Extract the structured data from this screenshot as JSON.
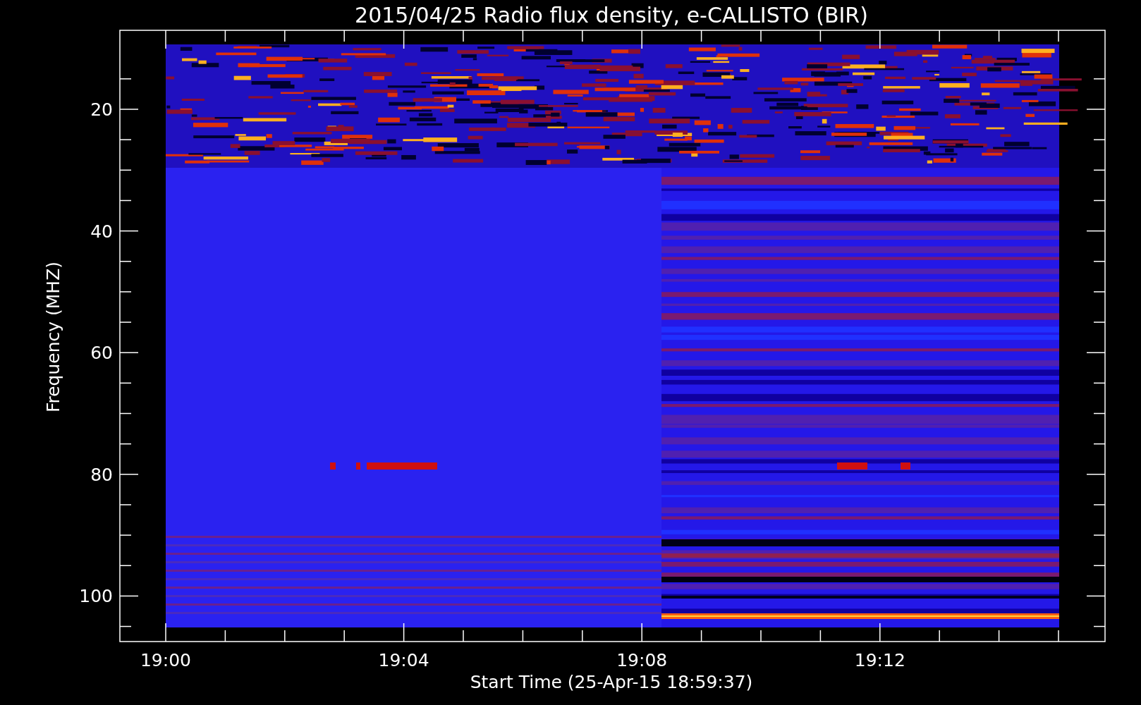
{
  "title": "2015/04/25  Radio flux density, e-CALLISTO (BIR)",
  "ylabel": "Frequency (MHZ)",
  "xlabel": "Start Time (25-Apr-15 18:59:37)",
  "y_ticks": [
    "20",
    "40",
    "60",
    "80",
    "100"
  ],
  "x_ticks": [
    "19:00",
    "19:04",
    "19:08",
    "19:12"
  ]
}
